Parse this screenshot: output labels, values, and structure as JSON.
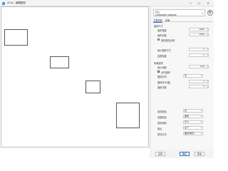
{
  "window": {
    "title": "xCut - 编辑图形",
    "min_glyph": "—",
    "max_glyph": "☐",
    "close_glyph": "✕"
  },
  "panel": {
    "preset": {
      "label": "预设",
      "value": "Complex shapes"
    },
    "tabs": [
      "主要参数",
      "布局"
    ],
    "page_section": {
      "title": "画布尺寸",
      "width_label": "画布宽度",
      "width_value": "1000",
      "height_label": "画布高度",
      "height_value": "1000",
      "lock_ratio_label": "保持宽高比例"
    },
    "shapes_section": {
      "count_label": "最小图形尺寸",
      "count_value": "1",
      "max_label": "边框厚度",
      "max_value": "1"
    },
    "layout_section": {
      "title": "布局选项",
      "spacing_label": "最小间距",
      "spacing_value": "1.00",
      "allow_rotate_label": "允许旋转",
      "rotate_mode_label": "旋转方向",
      "rotate_mode_value": "无",
      "rotate_step_label": "旋转步长(度)",
      "rotate_step_value": "1",
      "rotate_count_label": "旋转次数",
      "rotate_count_value": "1"
    },
    "output_section": {
      "fill_label": "填充颜色",
      "fill_value": "白",
      "stroke_label": "边框颜色",
      "stroke_value": "黑色",
      "sort_label": "排序规则",
      "sort_value": "尺寸",
      "origin_label": "原点",
      "origin_value": "左下",
      "mode_label": "排列方式",
      "mode_value": "面积(降序)"
    },
    "buttons": {
      "apply": "应用",
      "ok": "确定",
      "cancel": "取消"
    }
  }
}
